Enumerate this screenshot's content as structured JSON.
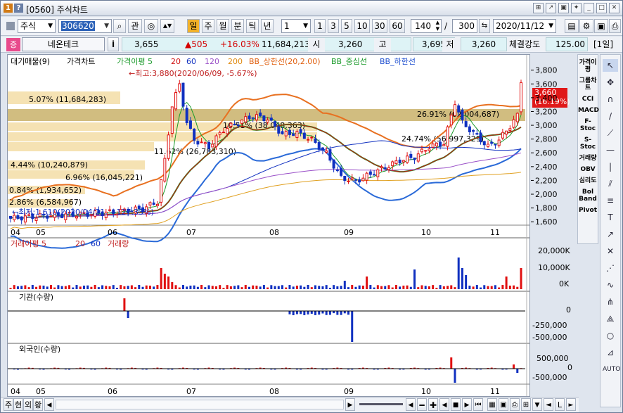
{
  "window": {
    "num": "1",
    "help": "?",
    "title": "[0560] 주식차트"
  },
  "toolbar": {
    "market": "주식",
    "code": "306620",
    "btn_gwan": "관",
    "periods": [
      "일",
      "주",
      "월",
      "분",
      "틱",
      "년"
    ],
    "interval": "1",
    "minute_buttons": [
      "1",
      "3",
      "5",
      "10",
      "30",
      "60"
    ],
    "count_a": "140",
    "slash": "/",
    "count_b": "300",
    "date": "2020/11/12"
  },
  "quote": {
    "badge": "증",
    "name": "네온테크",
    "info": "i",
    "price": "3,655",
    "change": "▲505",
    "rate": "+16.03%",
    "volume": "11,684,213",
    "open_label": "시",
    "open": "3,260",
    "high_label": "고",
    "high": "3,695",
    "low_label": "저",
    "low": "3,260",
    "strength_label": "체결강도",
    "strength": "125.00",
    "period_label": "[1일]"
  },
  "legend": {
    "vp": "대기매물(9)",
    "price": "가격차트",
    "ma": "가격이평 5",
    "ma20": "20",
    "ma60": "60",
    "ma120": "120",
    "ma200": "200",
    "bb_up": "BB_상한선(20,2.00)",
    "bb_mid": "BB_중심선",
    "bb_low": "BB_하한선"
  },
  "annotations": {
    "high": "←최고:3,880(2020/06/09, -5.67%)",
    "low": "←최저:1,610(2020/04/21, +127.33%)",
    "current": "3,660",
    "current_rate": "(16.19%)"
  },
  "volume_profile": [
    {
      "label": "5.07% (11,684,283)"
    },
    {
      "label": "26.91% (62,004,687)"
    },
    {
      "label": "16.51% (38,048,363)"
    },
    {
      "label": "24.74% (56,997,329)"
    },
    {
      "label": "11.62% (26,783,310)"
    },
    {
      "label": "4.44% (10,240,879)"
    },
    {
      "label": "6.96% (16,045,221)"
    },
    {
      "label": "0.84% (1,934,652)"
    },
    {
      "label": "2.86% (6,584,967)"
    }
  ],
  "price_axis": [
    "3,800",
    "3,600",
    "3,400",
    "3,200",
    "3,000",
    "2,800",
    "2,600",
    "2,400",
    "2,200",
    "2,000",
    "1,800",
    "1,600"
  ],
  "months": [
    "04",
    "05",
    "06",
    "07",
    "08",
    "09",
    "10",
    "11"
  ],
  "volume_panel": {
    "title": "거래이평 5",
    "p20": "20",
    "p60": "60",
    "vol": "거래량",
    "axis": [
      "20,000K",
      "10,000K",
      "0K"
    ]
  },
  "inst_panel": {
    "title": "기관(수량)",
    "axis": [
      "0",
      "-250,000",
      "-500,000"
    ]
  },
  "foreign_panel": {
    "title": "외국인(수량)",
    "axis": [
      "500,000",
      "0",
      "-500,000"
    ]
  },
  "right_tools": [
    "가격이평",
    "그룹차트",
    "CCI",
    "MACD",
    "F-Stoc",
    "S-Stoc",
    "거래량",
    "OBV",
    "심리도",
    "Bol Band",
    "Pivot"
  ],
  "draw_icons": [
    "cursor-icon",
    "pan-icon",
    "magnet-icon",
    "line-icon",
    "trendline-icon",
    "hline-icon",
    "vline-icon",
    "channel-icon",
    "fibo-icon",
    "text-icon",
    "arrow-icon",
    "cross-icon",
    "gann-icon",
    "cycle-icon",
    "pitchfork-icon",
    "speedline-icon",
    "circle-icon",
    "regression-icon",
    "auto-icon"
  ],
  "bottom": {
    "tabs": [
      "주",
      "현",
      "외",
      "황"
    ],
    "scale_right": "L"
  },
  "chart_data": {
    "type": "candlestick",
    "xlabels": [
      "04",
      "05",
      "06",
      "07",
      "08",
      "09",
      "10",
      "11"
    ],
    "y_range": [
      1600,
      3880
    ],
    "last_close": 3655,
    "volume_axis_max": "20,000K"
  }
}
